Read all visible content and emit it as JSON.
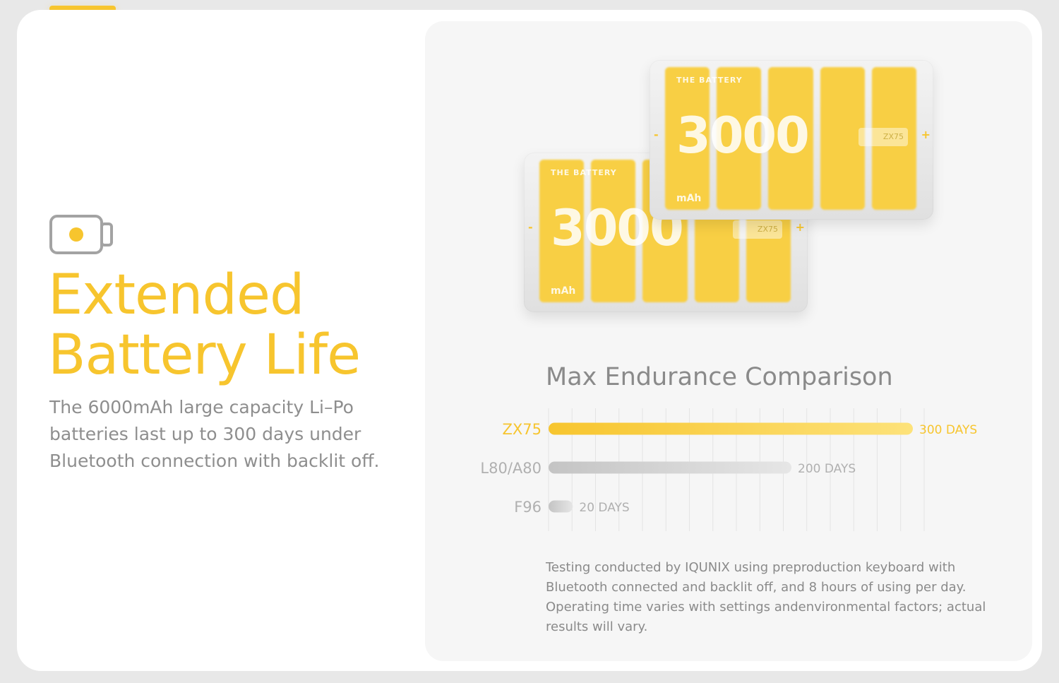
{
  "hero": {
    "headline_line1": "Extended",
    "headline_line2": "Battery Life",
    "description": "The 6000mAh large capacity Li–Po batteries last up to 300 days under Bluetooth connection with backlit off."
  },
  "battery_illustration": {
    "label": "THE BATTERY",
    "capacity": "3000",
    "unit": "mAh",
    "model": "ZX75",
    "minus": "-",
    "plus": "+"
  },
  "chart_title": "Max Endurance Comparison",
  "footnote": "Testing conducted by IQUNIX using preproduction keyboard with Bluetooth connected and backlit off, and 8 hours of using per day. Operating time varies with settings andenvironmental factors; actual results will vary.",
  "colors": {
    "accent": "#f7c52e",
    "accent_light": "#fde27a",
    "gray_bar": "#c8c8c8",
    "text_gray": "#8e8e8e",
    "label_gray": "#b0b0b0"
  },
  "chart_data": {
    "type": "bar",
    "orientation": "horizontal",
    "categories": [
      "ZX75",
      "L80/A80",
      "F96"
    ],
    "values": [
      300,
      200,
      20
    ],
    "data_labels": [
      "300 DAYS",
      "200 DAYS",
      "20 DAYS"
    ],
    "title": "Max Endurance Comparison",
    "xlabel": "",
    "ylabel": "",
    "xlim": [
      0,
      300
    ],
    "grid": true,
    "highlight_category": "ZX75"
  }
}
